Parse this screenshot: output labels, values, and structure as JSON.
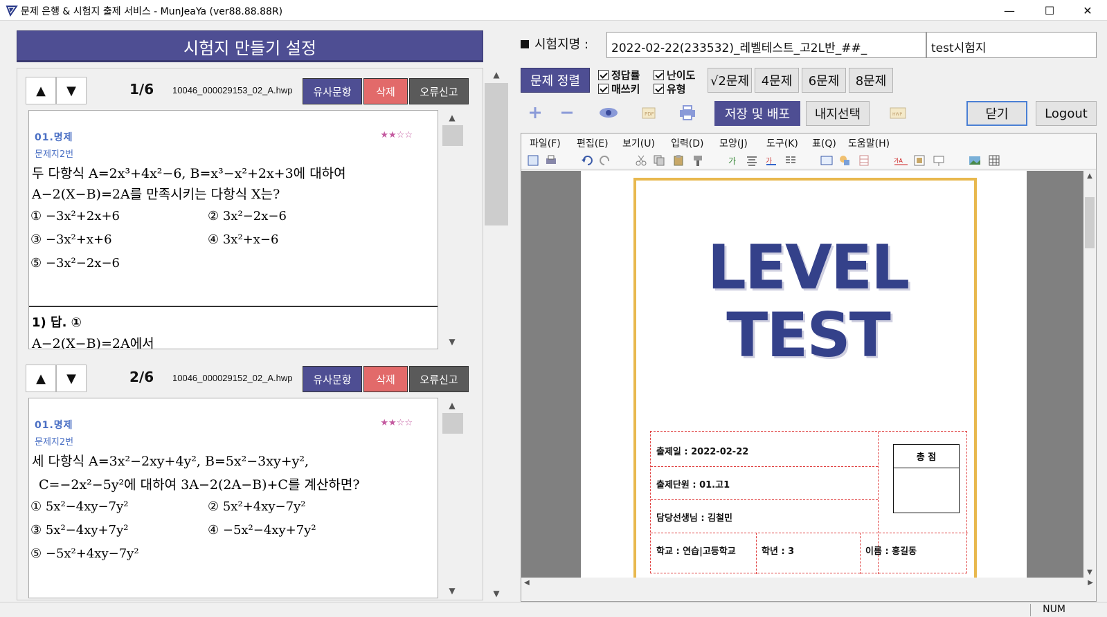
{
  "window": {
    "title": "문제 은행 & 시험지 출제 서비스 - MunJeaYa (ver88.88.88R)",
    "minimize": "—",
    "maximize": "☐",
    "close": "✕"
  },
  "left": {
    "header": "시험지 만들기 설정",
    "questions": [
      {
        "index": "1/6",
        "file": "10046_000029153_02_A.hwp",
        "btn_similar": "유사문항",
        "btn_delete": "삭제",
        "btn_report": "오류신고",
        "category": "01.명제",
        "sub": "문제지2번",
        "stars": "★★☆☆",
        "line1": "두 다항식 A=2x³+4x²−6, B=x³−x²+2x+3에 대하여",
        "line2": "A−2(X−B)=2A를 만족시키는 다항식 X는?",
        "c1": "① −3x²+2x+6",
        "c2": "② 3x²−2x−6",
        "c3": "③ −3x²+x+6",
        "c4": "④ 3x²+x−6",
        "c5": "⑤ −3x²−2x−6",
        "answer": "1) 답. ①",
        "solution": "A−2(X−B)=2A에서"
      },
      {
        "index": "2/6",
        "file": "10046_000029152_02_A.hwp",
        "btn_similar": "유사문항",
        "btn_delete": "삭제",
        "btn_report": "오류신고",
        "category": "01.명제",
        "sub": "문제지2번",
        "stars": "★★☆☆",
        "line1": "세 다항식 A=3x²−2xy+4y², B=5x²−3xy+y²,",
        "line2": "C=−2x²−5y²에 대하여 3A−2(2A−B)+C를 계산하면?",
        "c1": "① 5x²−4xy−7y²",
        "c2": "② 5x²+4xy−7y²",
        "c3": "③ 5x²−4xy+7y²",
        "c4": "④ −5x²−4xy+7y²",
        "c5": "⑤ −5x²+4xy−7y²"
      }
    ]
  },
  "right": {
    "exam_label": "시험지명 :",
    "exam_name": "2022-02-22(233532)_레벨테스트_고2L반_##_",
    "exam_title": "test시험지",
    "sort_button": "문제 정렬",
    "checks": {
      "answers": "정답률",
      "difficulty": "난이도",
      "handwriting": "매쓰키",
      "type": "유형"
    },
    "count_buttons": [
      "√2문제",
      "4문제",
      "6문제",
      "8문제"
    ],
    "save_button": "저장 및 배포",
    "paper_button": "내지선택",
    "close_button": "닫기",
    "logout_button": "Logout"
  },
  "editor": {
    "menu": [
      "파일(F)",
      "편집(E)",
      "보기(U)",
      "입력(D)",
      "모양(J)",
      "도구(K)",
      "표(Q)",
      "도움말(H)"
    ],
    "doc": {
      "title1": "LEVEL",
      "title2": "TEST",
      "date": "출제일 : 2022-02-22",
      "unit": "출제단원 : 01.고1",
      "teacher": "담당선생님 : 김철민",
      "school": "학교 : 연습|고등학교",
      "grade": "학년 : 3",
      "name": "이름 : 홍길동",
      "score_label": "총 점"
    }
  },
  "status": {
    "num": "NUM"
  }
}
